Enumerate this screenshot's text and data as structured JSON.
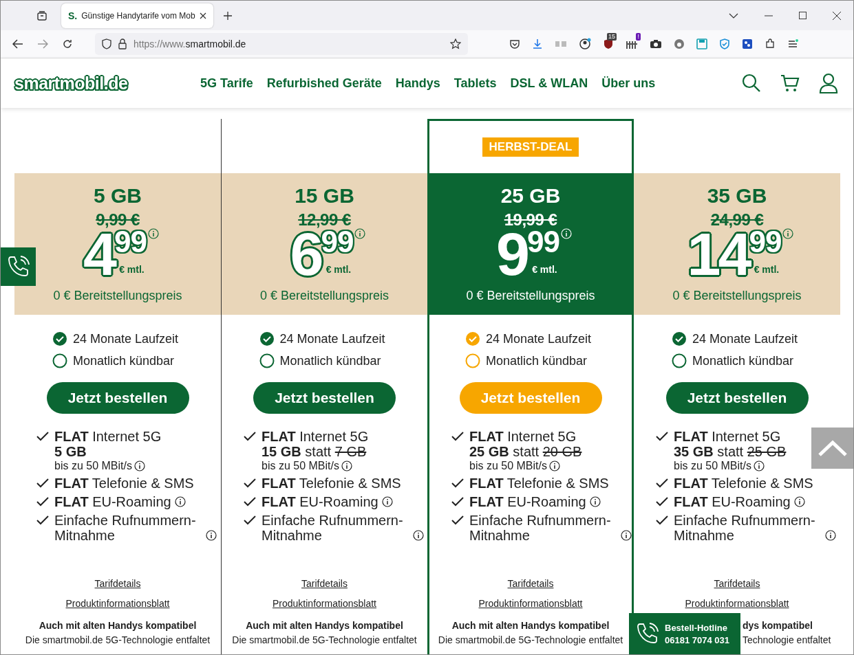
{
  "browser": {
    "tab_title": "Günstige Handytarife vom Mob",
    "favicon": "S.",
    "url_prefix": "https://www.",
    "url_host": "smartmobil.de",
    "extension_badges": [
      "15",
      "!"
    ]
  },
  "site": {
    "logo": "smartmobil.de",
    "nav": [
      "5G Tarife",
      "Refurbished Geräte",
      "Handys",
      "Tablets",
      "DSL & WLAN",
      "Über uns"
    ]
  },
  "cards": [
    {
      "highlighted": false,
      "covered": false,
      "volume": "5 GB",
      "old_price": "9,99 €",
      "price_int": "4",
      "price_dec": "99",
      "unit": "€ mtl.",
      "setup": "0 € Bereitstellungspreis",
      "options": [
        {
          "label": "24 Monate Laufzeit",
          "checked": true
        },
        {
          "label": "Monatlich kündbar",
          "checked": false
        }
      ],
      "button": "Jetzt bestellen",
      "internet": {
        "text": "**FLAT** Internet 5G",
        "volume": "5 GB",
        "speed": "bis zu 50 MBit/s"
      },
      "features": [
        {
          "text": "**FLAT** Telefonie & SMS",
          "info": false
        },
        {
          "text": "**FLAT** EU-Roaming",
          "info": true
        },
        {
          "text": "Einfache Rufnummern-Mitnahme",
          "info": true
        }
      ],
      "links": [
        "Tarifdetails",
        "Produktinformationsblatt"
      ],
      "compat": "Auch mit alten Handys kompatibel",
      "desc": "Die smartmobil.de 5G-Technologie entfaltet"
    },
    {
      "highlighted": false,
      "covered": false,
      "volume": "15 GB",
      "old_price": "12,99 €",
      "price_int": "6",
      "price_dec": "99",
      "unit": "€ mtl.",
      "setup": "0 € Bereitstellungspreis",
      "options": [
        {
          "label": "24 Monate Laufzeit",
          "checked": true
        },
        {
          "label": "Monatlich kündbar",
          "checked": false
        }
      ],
      "button": "Jetzt bestellen",
      "internet": {
        "text": "**FLAT** Internet 5G",
        "volume": "15 GB",
        "statt": "statt",
        "old_volume": "7 GB",
        "speed": "bis zu 50 MBit/s"
      },
      "features": [
        {
          "text": "**FLAT** Telefonie & SMS",
          "info": false
        },
        {
          "text": "**FLAT** EU-Roaming",
          "info": true
        },
        {
          "text": "Einfache Rufnummern-Mitnahme",
          "info": true
        }
      ],
      "links": [
        "Tarifdetails",
        "Produktinformationsblatt"
      ],
      "compat": "Auch mit alten Handys kompatibel",
      "desc": "Die smartmobil.de 5G-Technologie entfaltet"
    },
    {
      "highlighted": true,
      "covered": false,
      "badge": "HERBST-DEAL",
      "volume": "25 GB",
      "old_price": "19,99 €",
      "price_int": "9",
      "price_dec": "99",
      "unit": "€ mtl.",
      "setup": "0 € Bereitstellungspreis",
      "options": [
        {
          "label": "24 Monate Laufzeit",
          "checked": true
        },
        {
          "label": "Monatlich kündbar",
          "checked": false
        }
      ],
      "button": "Jetzt bestellen",
      "internet": {
        "text": "**FLAT** Internet 5G",
        "volume": "25 GB",
        "statt": "statt",
        "old_volume": "20 GB",
        "speed": "bis zu 50 MBit/s"
      },
      "features": [
        {
          "text": "**FLAT** Telefonie & SMS",
          "info": false
        },
        {
          "text": "**FLAT** EU-Roaming",
          "info": true
        },
        {
          "text": "Einfache Rufnummern-Mitnahme",
          "info": true
        }
      ],
      "links": [
        "Tarifdetails",
        "Produktinformationsblatt"
      ],
      "compat": "Auch mit alten Handys kompatibel",
      "desc": "Die smartmobil.de 5G-Technologie entfaltet"
    },
    {
      "highlighted": false,
      "covered": true,
      "volume": "35 GB",
      "old_price": "24,99 €",
      "price_int": "14",
      "price_dec": "99",
      "unit": "€ mtl.",
      "setup": "0 € Bereitstellungspreis",
      "options": [
        {
          "label": "24 Monate Laufzeit",
          "checked": true
        },
        {
          "label": "Monatlich kündbar",
          "checked": false
        }
      ],
      "button": "Jetzt bestellen",
      "internet": {
        "text": "**FLAT** Internet 5G",
        "volume": "35 GB",
        "statt": "statt",
        "old_volume": "25 GB",
        "speed": "bis zu 50 MBit/s"
      },
      "features": [
        {
          "text": "**FLAT** Telefonie & SMS",
          "info": false
        },
        {
          "text": "**FLAT** EU-Roaming",
          "info": true
        },
        {
          "text": "Einfache Rufnummern-Mitnahme",
          "info": true
        }
      ],
      "links": [
        "Tarifdetails",
        "Produktinformationsblatt"
      ],
      "compat": "dys kompatibel",
      "desc": "Technologie entfaltet"
    }
  ],
  "hotline": {
    "title": "Bestell-Hotline",
    "number": "06181 7074 031"
  }
}
